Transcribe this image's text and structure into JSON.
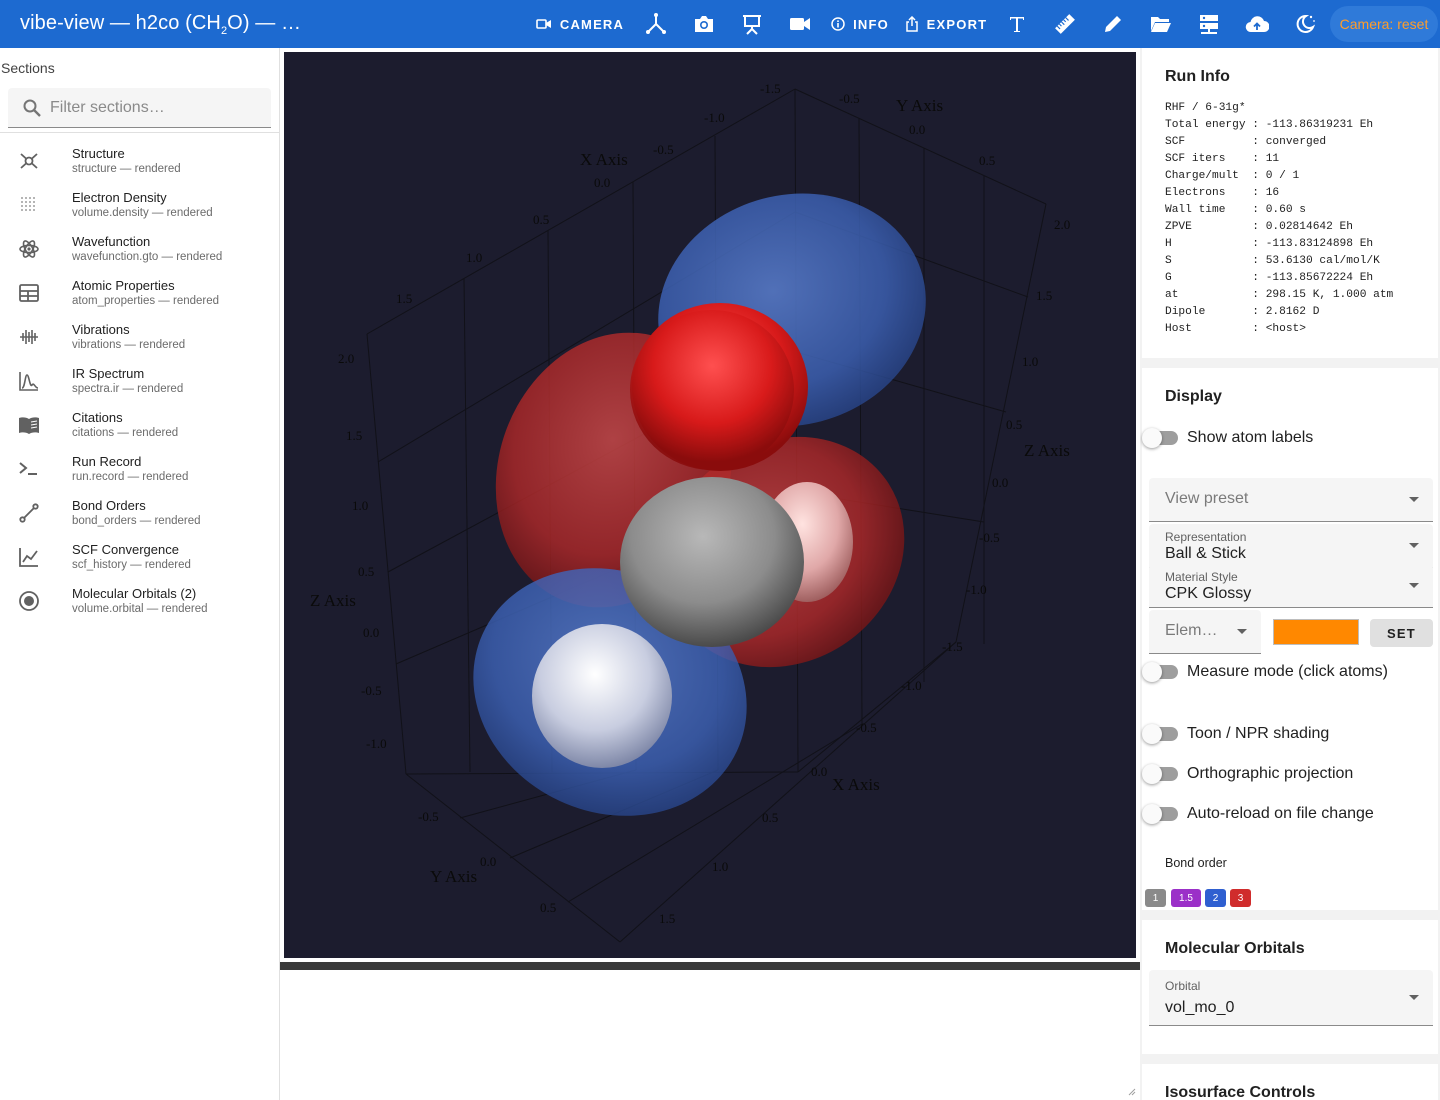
{
  "app": {
    "title_main": "vibe-view — h2co (CH",
    "title_sub": "2",
    "title_tail": "O) — …"
  },
  "toolbar": {
    "camera_label": "CAMERA",
    "info_label": "INFO",
    "export_label": "EXPORT",
    "camera_chip": "Camera: reset",
    "icons": [
      "camera-icon",
      "axes-icon",
      "screenshot-icon",
      "presentation-icon",
      "video-icon",
      "info-icon",
      "export-icon",
      "text-icon",
      "ruler-icon",
      "pencil-icon",
      "folder-icon",
      "server-icon",
      "cloud-upload-icon",
      "theme-toggle-icon"
    ]
  },
  "sidebar": {
    "title": "Sections",
    "filter_placeholder": "Filter sections…",
    "items": [
      {
        "label": "Structure",
        "sub": "structure — rendered",
        "icon": "molecule-icon"
      },
      {
        "label": "Electron Density",
        "sub": "volume.density — rendered",
        "icon": "dots-grid-icon"
      },
      {
        "label": "Wavefunction",
        "sub": "wavefunction.gto — rendered",
        "icon": "atom-icon"
      },
      {
        "label": "Atomic Properties",
        "sub": "atom_properties — rendered",
        "icon": "table-icon"
      },
      {
        "label": "Vibrations",
        "sub": "vibrations — rendered",
        "icon": "waveform-icon"
      },
      {
        "label": "IR Spectrum",
        "sub": "spectra.ir — rendered",
        "icon": "spectrum-icon"
      },
      {
        "label": "Citations",
        "sub": "citations — rendered",
        "icon": "book-icon"
      },
      {
        "label": "Run Record",
        "sub": "run.record — rendered",
        "icon": "terminal-icon"
      },
      {
        "label": "Bond Orders",
        "sub": "bond_orders — rendered",
        "icon": "bond-icon"
      },
      {
        "label": "SCF Convergence",
        "sub": "scf_history — rendered",
        "icon": "line-chart-icon"
      },
      {
        "label": "Molecular Orbitals (2)",
        "sub": "volume.orbital — rendered",
        "icon": "orbital-icon"
      }
    ]
  },
  "viewer": {
    "axis_titles": {
      "x": "X Axis",
      "y": "Y Axis",
      "z": "Z Axis"
    },
    "ticks": [
      "-1.5",
      "-1.0",
      "-0.5",
      "0.0",
      "0.5",
      "1.0",
      "1.5",
      "2.0"
    ],
    "colors": {
      "background": "#1c1c2e",
      "lobe_positive": "#3d63b8",
      "lobe_negative": "#b02828",
      "oxygen": "#e01818",
      "carbon": "#8c8c8c",
      "hydrogen": "#e6e6f2"
    }
  },
  "run_info": {
    "title": "Run Info",
    "lines": [
      "RHF / 6-31g*",
      "Total energy : -113.86319231 Eh",
      "SCF          : converged",
      "SCF iters    : 11",
      "Charge/mult  : 0 / 1",
      "Electrons    : 16",
      "Wall time    : 0.60 s",
      "ZPVE         : 0.02814642 Eh",
      "H            : -113.83124898 Eh",
      "S            : 53.6130 cal/mol/K",
      "G            : -113.85672224 Eh",
      "at           : 298.15 K, 1.000 atm",
      "Dipole       : 2.8162 D",
      "Host         : <host>"
    ]
  },
  "display": {
    "title": "Display",
    "show_atom_labels": "Show atom labels",
    "view_preset_placeholder": "View preset",
    "representation_label": "Representation",
    "representation_value": "Ball & Stick",
    "material_label": "Material Style",
    "material_value": "CPK Glossy",
    "element_placeholder": "Elem…",
    "element_color": "#ff8800",
    "set_button": "SET",
    "measure_mode": "Measure mode (click atoms)",
    "toon": "Toon / NPR shading",
    "ortho": "Orthographic projection",
    "autoreload": "Auto-reload on file change",
    "bond_order_label": "Bond order",
    "bond_orders": [
      {
        "label": "1",
        "color": "#8a8a8a"
      },
      {
        "label": "1.5",
        "color": "#9b30c8"
      },
      {
        "label": "2",
        "color": "#2f5fd0"
      },
      {
        "label": "3",
        "color": "#d02c2c"
      }
    ]
  },
  "molecular_orbitals": {
    "title": "Molecular Orbitals",
    "orbital_label": "Orbital",
    "orbital_value": "vol_mo_0"
  },
  "isosurface": {
    "title": "Isosurface Controls"
  }
}
